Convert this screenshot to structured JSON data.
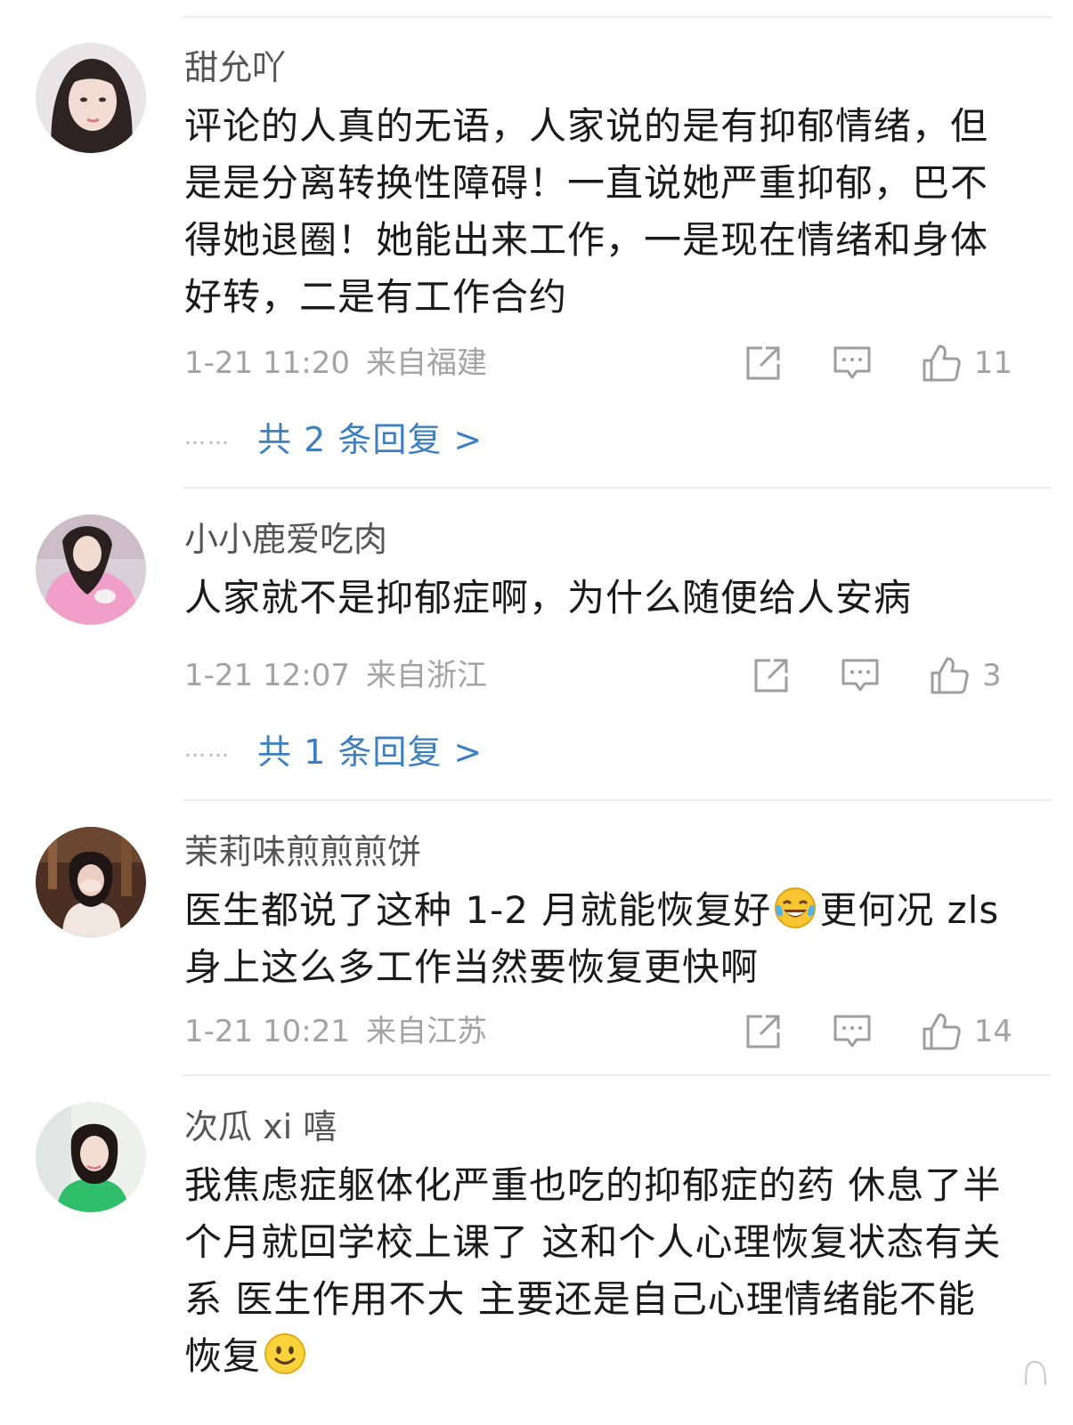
{
  "comments": [
    {
      "username": "甜允吖",
      "lines": [
        "评论的人真的无语，人家说的是有抑郁情绪，但",
        "是是分离转换性障碍！一直说她严重抑郁，巴不",
        "得她退圈！她能出来工作，一是现在情绪和身体",
        "好转，二是有工作合约"
      ],
      "time": "1-21 11:20",
      "location": "来自福建",
      "likes": "11",
      "replies_dots": "……",
      "replies_label": "共 2 条回复 >"
    },
    {
      "username": "小小鹿爱吃肉",
      "lines": [
        "人家就不是抑郁症啊，为什么随便给人安病"
      ],
      "time": "1-21 12:07",
      "location": "来自浙江",
      "likes": "3",
      "replies_dots": "……",
      "replies_label": "共 1 条回复 >"
    },
    {
      "username": "茉莉味煎煎煎饼",
      "line1_a": "医生都说了这种 1-2 月就能恢复好",
      "line1_b": "更何况 zls",
      "line2": "身上这么多工作当然要恢复更快啊",
      "emoji": "laugh-cry-emoji",
      "time": "1-21 10:21",
      "location": "来自江苏",
      "likes": "14"
    },
    {
      "username": "次瓜 xi 嘻",
      "lines": [
        "我焦虑症躯体化严重也吃的抑郁症的药 休息了半",
        "个月就回学校上课了 这和个人心理恢复状态有关",
        "系 医生作用不大 主要还是自己心理情绪能不能"
      ],
      "last_line": "恢复",
      "emoji": "smile-emoji"
    }
  ],
  "colors": {
    "text": "#1a1a1a",
    "username": "#555555",
    "meta": "#a3a3a3",
    "link": "#3d7fc0",
    "divider": "#ececec"
  }
}
